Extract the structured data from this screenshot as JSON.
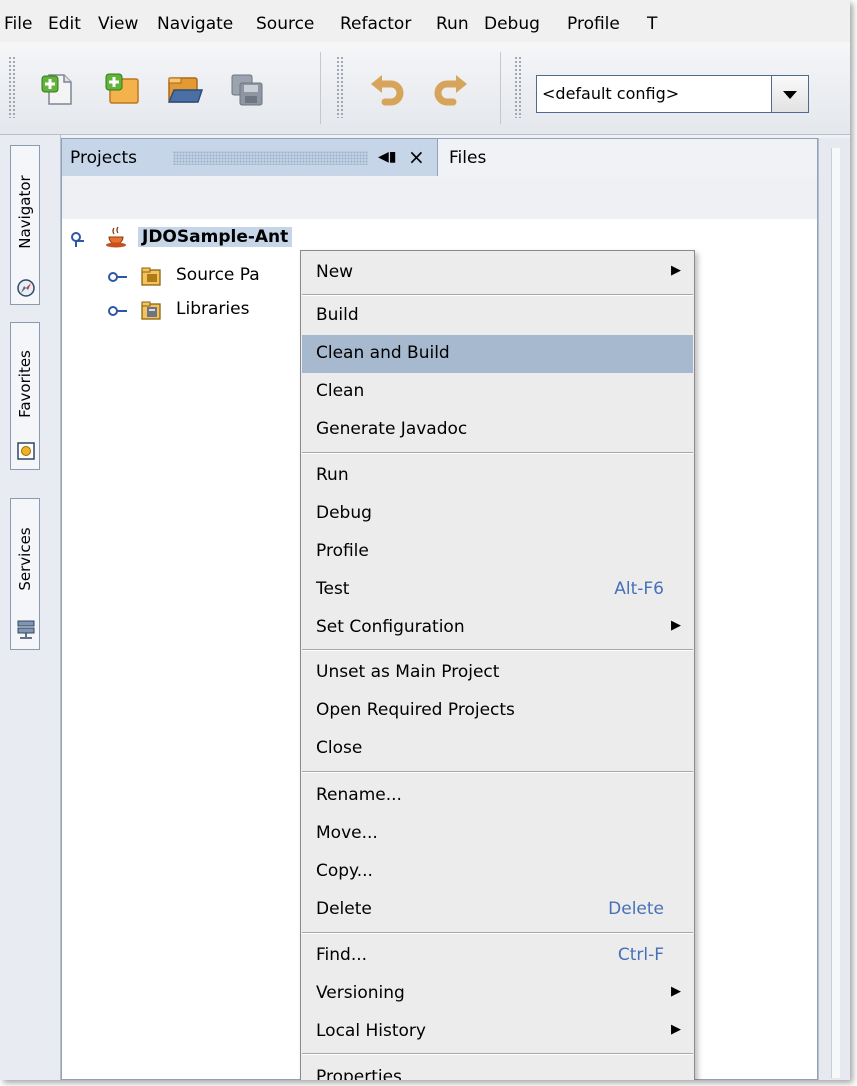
{
  "menubar": {
    "items": [
      "File",
      "Edit",
      "View",
      "Navigate",
      "Source",
      "Refactor",
      "Run",
      "Debug",
      "Profile",
      "T"
    ]
  },
  "toolbar": {
    "config_value": "<default config>"
  },
  "side_tabs": {
    "navigator": "Navigator",
    "favorites": "Favorites",
    "services": "Services"
  },
  "panel": {
    "tab_projects": "Projects",
    "tab_files": "Files",
    "tree": {
      "project": "JDOSample-Ant",
      "source": "Source Pa",
      "libraries": "Libraries"
    }
  },
  "context_menu": {
    "items": [
      {
        "label": "New",
        "submenu": true
      },
      {
        "label": "Build"
      },
      {
        "label": "Clean and Build",
        "selected": true
      },
      {
        "label": "Clean"
      },
      {
        "label": "Generate Javadoc"
      },
      {
        "label": "Run"
      },
      {
        "label": "Debug"
      },
      {
        "label": "Profile"
      },
      {
        "label": "Test",
        "shortcut": "Alt-F6"
      },
      {
        "label": "Set Configuration",
        "submenu": true
      },
      {
        "label": "Unset as Main Project"
      },
      {
        "label": "Open Required Projects"
      },
      {
        "label": "Close"
      },
      {
        "label": "Rename..."
      },
      {
        "label": "Move..."
      },
      {
        "label": "Copy..."
      },
      {
        "label": "Delete",
        "shortcut": "Delete"
      },
      {
        "label": "Find...",
        "shortcut": "Ctrl-F"
      },
      {
        "label": "Versioning",
        "submenu": true
      },
      {
        "label": "Local History",
        "submenu": true
      },
      {
        "label": "Properties"
      }
    ]
  },
  "colors": {
    "selection": "#a6b9cf",
    "tab_active": "#c6d6e8",
    "shortcut": "#4870b8"
  }
}
